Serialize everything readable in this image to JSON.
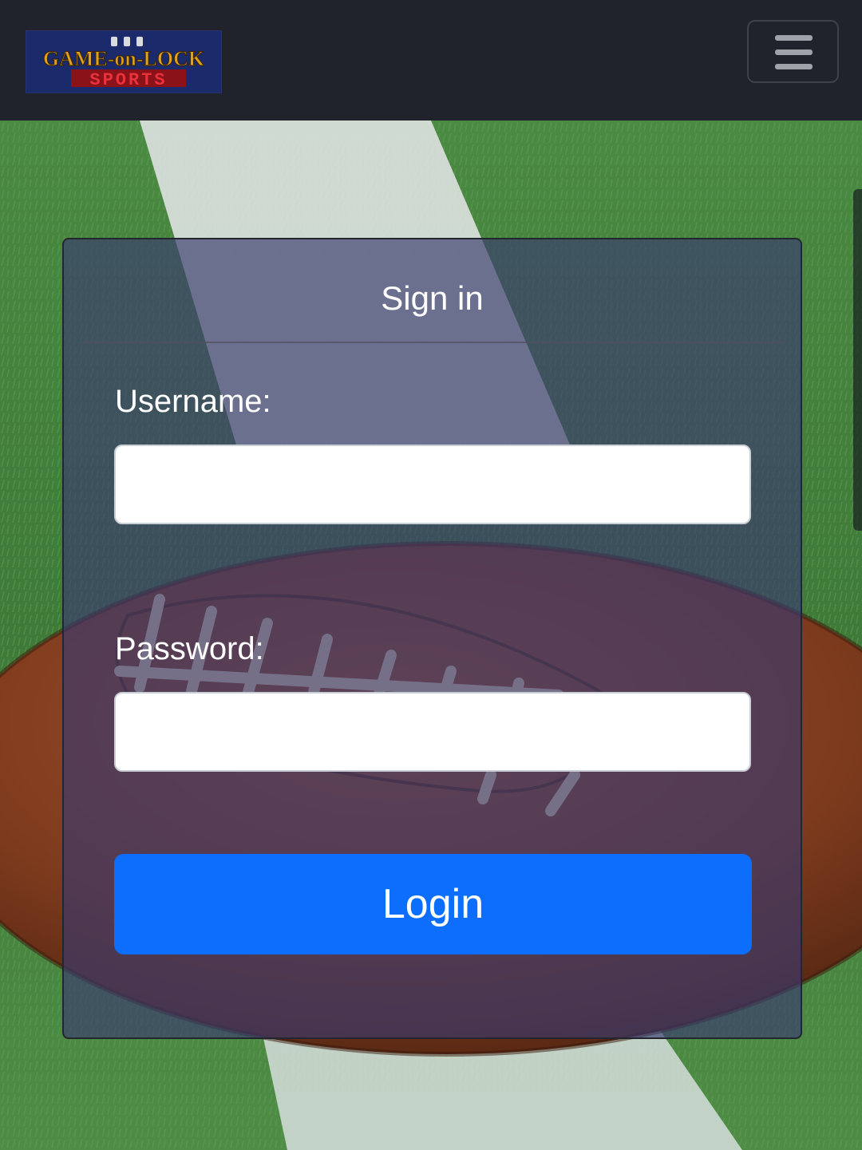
{
  "navbar": {
    "logo": {
      "line1": "GAME-on-LOCK",
      "line2": "SPORTS",
      "icon": "padlock-icon"
    },
    "menu_icon": "hamburger-menu-icon"
  },
  "signin": {
    "title": "Sign in",
    "username_label": "Username:",
    "username_value": "",
    "password_label": "Password:",
    "password_value": "",
    "login_label": "Login"
  },
  "colors": {
    "navbar_bg": "#20232b",
    "card_overlay": "#3a3a6e",
    "primary_button": "#0d6efd",
    "logo_gold": "#e0a21a",
    "logo_red": "#d8202a"
  }
}
